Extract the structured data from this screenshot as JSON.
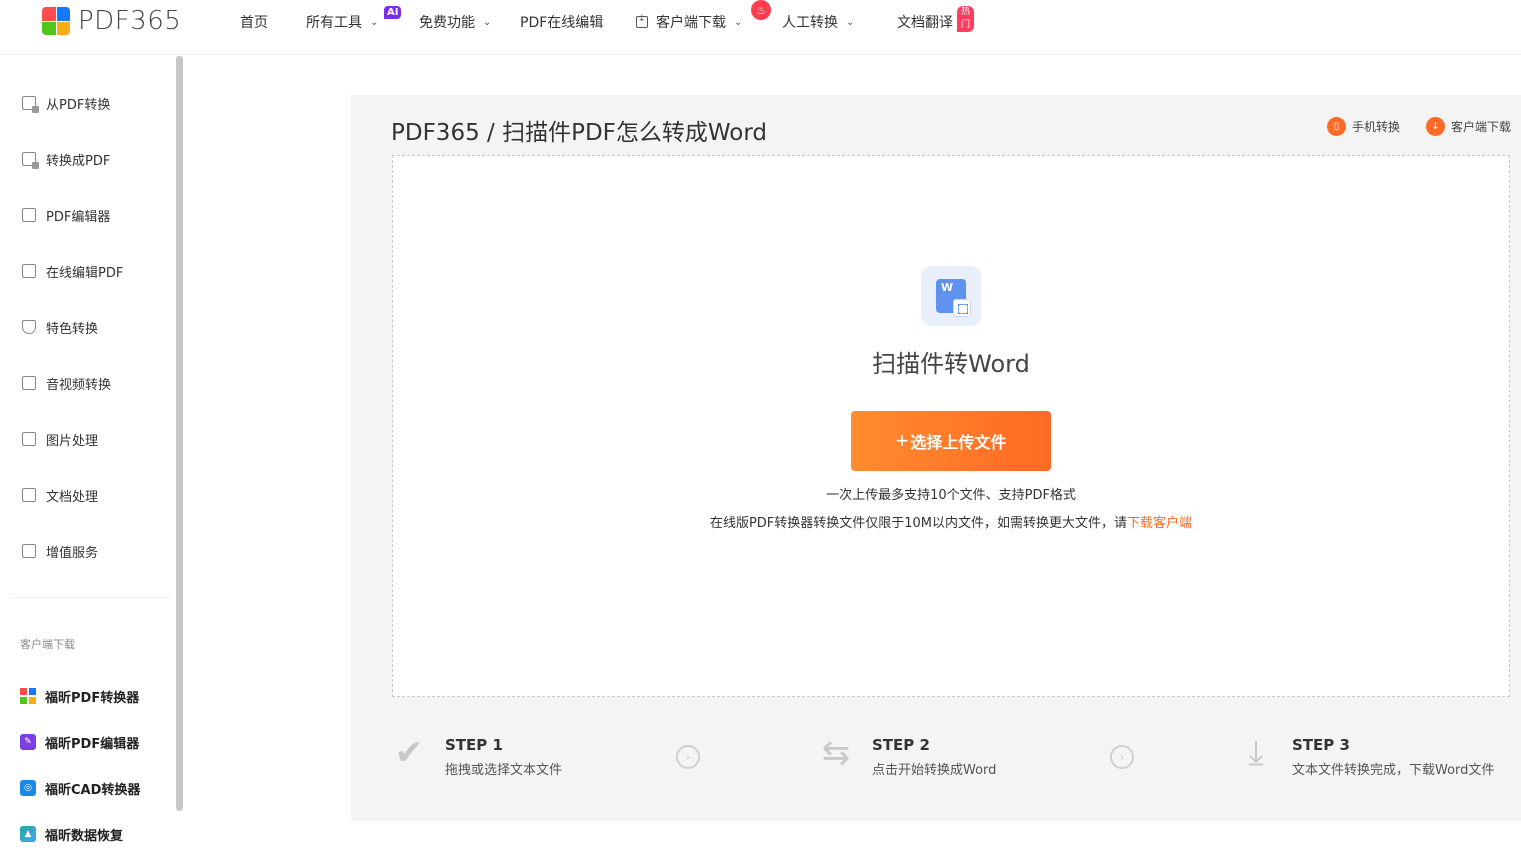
{
  "brand": {
    "name": "PDF365",
    "logo_colors": [
      "#ff4d4f",
      "#1677ff",
      "#52c41a",
      "#faad14"
    ]
  },
  "nav": {
    "home": "首页",
    "all_tools": "所有工具",
    "ai_badge": "AI",
    "free": "免费功能",
    "online_edit": "PDF在线编辑",
    "client_download": "客户端下载",
    "manual": "人工转换",
    "translate": "文档翻译",
    "hot_badge": "热门"
  },
  "sidebar": {
    "items": [
      {
        "label": "从PDF转换",
        "icon": "pdf-from-icon"
      },
      {
        "label": "转换成PDF",
        "icon": "pdf-to-icon"
      },
      {
        "label": "PDF编辑器",
        "icon": "pdf-editor-icon"
      },
      {
        "label": "在线编辑PDF",
        "icon": "online-edit-icon"
      },
      {
        "label": "特色转换",
        "icon": "star-shield-icon"
      },
      {
        "label": "音视频转换",
        "icon": "media-icon"
      },
      {
        "label": "图片处理",
        "icon": "image-icon"
      },
      {
        "label": "文档处理",
        "icon": "document-icon"
      },
      {
        "label": "增值服务",
        "icon": "list-icon"
      }
    ],
    "client_caption": "客户端下载",
    "clients": [
      {
        "label": "福昕PDF转换器",
        "color": "#1677ff"
      },
      {
        "label": "福昕PDF编辑器",
        "color": "#7b3fe4"
      },
      {
        "label": "福昕CAD转换器",
        "color": "#1e88e5"
      },
      {
        "label": "福昕数据恢复",
        "color": "#26a69a"
      }
    ]
  },
  "main": {
    "breadcrumb": "PDF365 / 扫描件PDF怎么转成Word",
    "mobile_link": "手机转换",
    "client_link": "客户端下载",
    "tool_title": "扫描件转Word",
    "upload_button": "选择上传文件",
    "hint_line1": "一次上传最多支持10个文件、支持PDF格式",
    "hint_line2_prefix": "在线版PDF转换器转换文件仅限于10M以内文件，如需转换更大文件，请",
    "hint_line2_link": "下载客户端",
    "accent_color": "#ff6a24"
  },
  "steps": [
    {
      "title": "STEP 1",
      "desc": "拖拽或选择文本文件",
      "icon": "check-icon"
    },
    {
      "title": "STEP 2",
      "desc": "点击开始转换成Word",
      "icon": "swap-arrows-icon"
    },
    {
      "title": "STEP 3",
      "desc": "文本文件转换完成，下载Word文件",
      "icon": "download-tray-icon"
    }
  ]
}
